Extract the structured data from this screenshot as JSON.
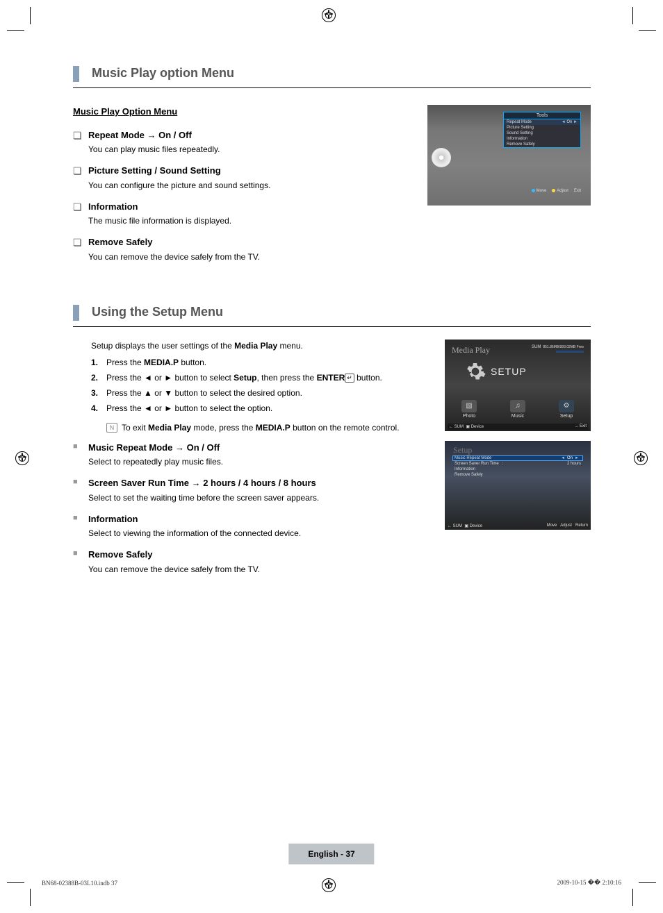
{
  "sections": {
    "music_play_option_menu": {
      "header": "Music Play option Menu",
      "subtitle": "Music Play Option Menu",
      "items": [
        {
          "title": "Repeat Mode → On / Off",
          "desc": "You can play music files repeatedly."
        },
        {
          "title": "Picture Setting / Sound Setting",
          "desc": "You can configure the picture and sound settings."
        },
        {
          "title": "Information",
          "desc": "The music file information is displayed."
        },
        {
          "title": "Remove Safely",
          "desc": "You can remove the device safely from the TV."
        }
      ]
    },
    "using_setup_menu": {
      "header": "Using the Setup Menu",
      "intro_prefix": "Setup displays the user settings of the ",
      "intro_bold": "Media Play",
      "intro_suffix": " menu.",
      "steps": [
        {
          "pre": "Press the ",
          "b1": "MEDIA.P",
          "post": " button."
        },
        {
          "pre": "Press the ◄ or ► button to select ",
          "b1": "Setup",
          "mid": ", then press the ",
          "b2": "ENTER",
          "post": " button."
        },
        {
          "pre": "Press the ▲ or ▼ button to select the desired option.",
          "b1": "",
          "post": ""
        },
        {
          "pre": "Press the ◄ or ► button to select the option.",
          "b1": "",
          "post": ""
        }
      ],
      "note_pre": "To exit ",
      "note_b1": "Media Play",
      "note_mid": " mode, press the ",
      "note_b2": "MEDIA.P",
      "note_post": " button on the remote control.",
      "sub_items": [
        {
          "title": "Music Repeat Mode → On / Off",
          "desc": "Select to repeatedly play music files."
        },
        {
          "title": "Screen Saver Run Time → 2 hours / 4 hours / 8 hours",
          "desc": "Select to set the waiting time before the screen saver appears."
        },
        {
          "title": "Information",
          "desc": "Select to viewing the information of the connected device."
        },
        {
          "title": "Remove Safely",
          "desc": "You can remove the device safely from the TV."
        }
      ]
    }
  },
  "mock1": {
    "title": "Tools",
    "rows": [
      "Repeat Mode",
      "Picture Setting",
      "Sound Setting",
      "Information",
      "Remove Safely"
    ],
    "value_on": "On",
    "footer": [
      "Move",
      "Adjust",
      "Exit"
    ]
  },
  "mock2": {
    "title": "Media Play",
    "sum": "SUM",
    "sum_label": "851.86MB/993.02MB Free",
    "big": "SETUP",
    "items": [
      "Photo",
      "Music",
      "Setup"
    ],
    "footer_left_a": "SUM",
    "footer_left_b": "Device",
    "footer_right": "Exit"
  },
  "mock3": {
    "head": "Setup",
    "rows": [
      {
        "label": "Music Repeat Mode",
        "value": "On",
        "hl": true
      },
      {
        "label": "Screen Saver Run Time",
        "value": "2 hours",
        "hl": false
      },
      {
        "label": "Information",
        "value": "",
        "hl": false
      },
      {
        "label": "Remove Safely",
        "value": "",
        "hl": false
      }
    ],
    "footer_left_a": "SUM",
    "footer_left_b": "Device",
    "footer_right": [
      "Move",
      "Adjust",
      "Return"
    ]
  },
  "page_foot": "English - 37",
  "indd_left": "BN68-02388B-03L10.indb   37",
  "indd_right": "2009-10-15   �� 2:10:16"
}
